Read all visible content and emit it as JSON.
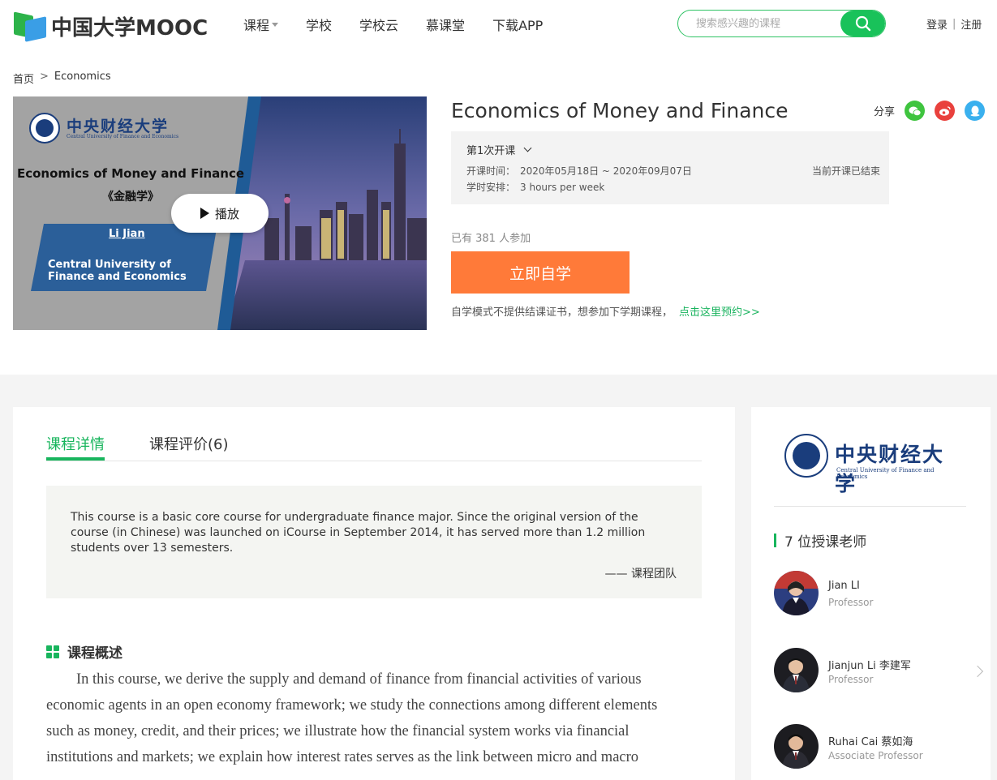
{
  "header": {
    "logo_text": "中国大学MOOC",
    "nav": [
      {
        "label": "课程",
        "has_dropdown": true
      },
      {
        "label": "学校"
      },
      {
        "label": "学校云"
      },
      {
        "label": "慕课堂"
      },
      {
        "label": "下载APP"
      }
    ],
    "search_placeholder": "搜索感兴趣的课程",
    "login": "登录",
    "register": "注册"
  },
  "breadcrumb": {
    "home": "首页",
    "separator": ">",
    "current": "Economics"
  },
  "cover": {
    "university_cn": "中央财经大学",
    "university_en": "Central University of Finance and Economics",
    "title": "Economics of Money and  Finance",
    "title_cn": "《金融学》",
    "author": "Li   Jian",
    "institution": "Central University of Finance and Economics",
    "play_label": "播放"
  },
  "course": {
    "title": "Economics of Money and Finance",
    "share_label": "分享",
    "share_icons": [
      "wechat-icon",
      "weibo-icon",
      "qq-icon"
    ],
    "term": "第1次开课",
    "schedule_label": "开课时间：",
    "schedule_value": "2020年05月18日 ~ 2020年09月07日",
    "hours_label": "学时安排：",
    "hours_value": "3 hours per week",
    "status": "当前开课已结束",
    "enrolled": "已有 381 人参加",
    "study_button": "立即自学",
    "note": "自学模式不提供结课证书，想参加下学期课程，",
    "note_link": "点击这里预约>>"
  },
  "tabs": [
    {
      "label": "课程详情",
      "active": true
    },
    {
      "label": "课程评价(6)",
      "active": false
    }
  ],
  "quote": {
    "text": "This course is a basic core course for undergraduate finance major. Since the original version of the course (in Chinese) was launched on iCourse in September 2014, it has served more than 1.2 million students over 13 semesters.",
    "author": "—— 课程团队"
  },
  "overview": {
    "heading": "课程概述",
    "text": "In this course, we derive the supply and demand of finance from financial activities of various economic agents in an open economy framework; we study the connections among different elements such as money, credit, and their prices; we illustrate how the financial system works via financial institutions and markets; we explain how interest rates serves as the link between micro and macro"
  },
  "sidebar": {
    "university_cn": "中央财经大学",
    "university_en": "Central University of Finance and Economics",
    "teachers_heading": "7 位授课老师",
    "teachers": [
      {
        "name": "Jian LI",
        "role": "Professor"
      },
      {
        "name": "Jianjun Li 李建军",
        "role": "Professor"
      },
      {
        "name": "Ruhai Cai 蔡如海",
        "role": "Associate Professor"
      }
    ]
  },
  "colors": {
    "brand_green": "#18b55d",
    "cta_orange": "#ff7a39",
    "link_green": "#19b35e"
  }
}
